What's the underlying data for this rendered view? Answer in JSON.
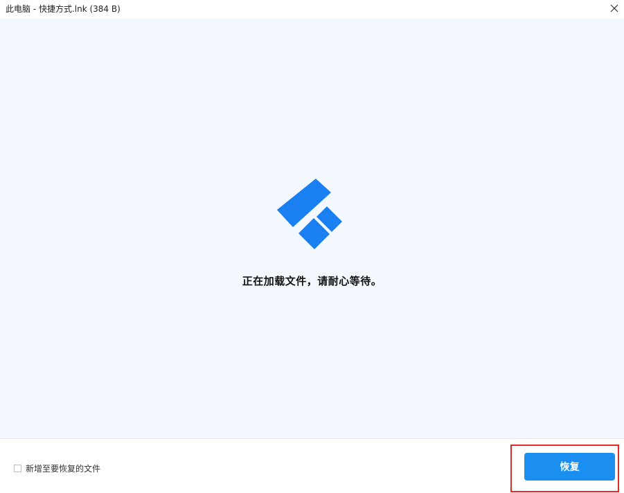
{
  "window": {
    "title": "此电脑 - 快捷方式.lnk (384 B)",
    "close_icon": "close-icon"
  },
  "main": {
    "loader_icon": "loading-logo-icon",
    "loading_text": "正在加载文件，请耐心等待。"
  },
  "footer": {
    "add_option_label": "新增至要恢复的文件",
    "add_option_checked": false,
    "recover_label": "恢复"
  },
  "colors": {
    "accent": "#1a8ff0",
    "logo": "#1a7ff0",
    "content_bg": "#f3f8fe",
    "highlight": "#e02a2a"
  }
}
